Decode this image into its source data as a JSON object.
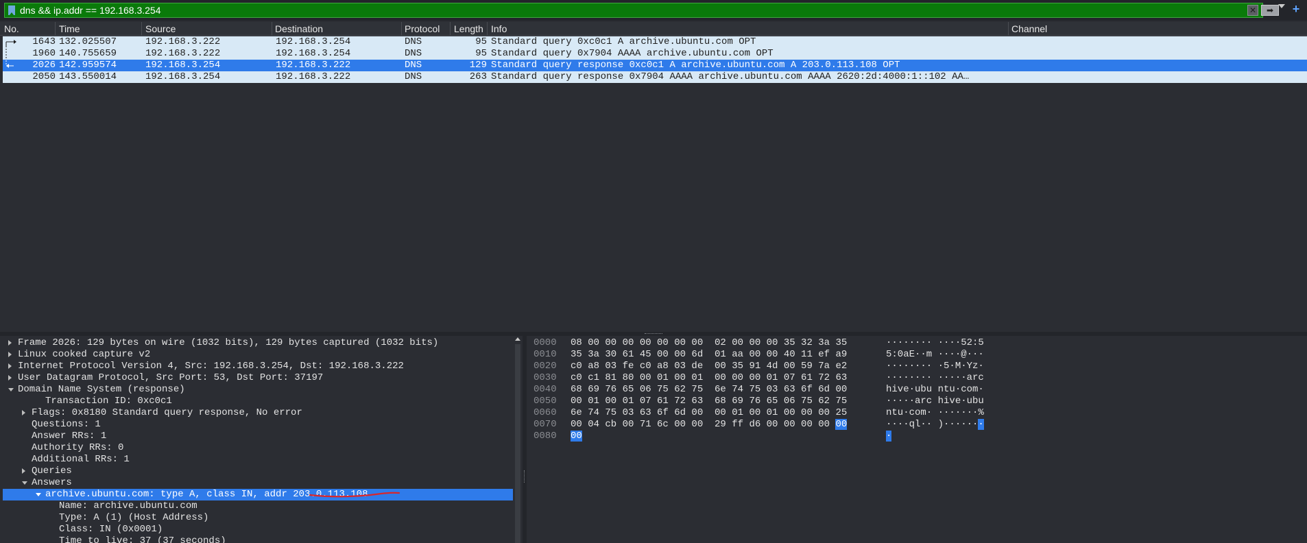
{
  "filter": {
    "text": "dns && ip.addr == 192.168.3.254",
    "clear_label": "✕",
    "apply_label": "➡",
    "add_label": "+"
  },
  "packet_list": {
    "columns": [
      "No.",
      "Time",
      "Source",
      "Destination",
      "Protocol",
      "Length",
      "Info",
      "Channel"
    ],
    "rows": [
      {
        "no": "1643",
        "time": "132.025507",
        "src": "192.168.3.222",
        "dst": "192.168.3.254",
        "proto": "DNS",
        "len": "95",
        "info": "Standard query 0xc0c1 A archive.ubuntu.com OPT",
        "selected": false
      },
      {
        "no": "1960",
        "time": "140.755659",
        "src": "192.168.3.222",
        "dst": "192.168.3.254",
        "proto": "DNS",
        "len": "95",
        "info": "Standard query 0x7904 AAAA archive.ubuntu.com OPT",
        "selected": false
      },
      {
        "no": "2026",
        "time": "142.959574",
        "src": "192.168.3.254",
        "dst": "192.168.3.222",
        "proto": "DNS",
        "len": "129",
        "info": "Standard query response 0xc0c1 A archive.ubuntu.com A 203.0.113.108 OPT",
        "selected": true
      },
      {
        "no": "2050",
        "time": "143.550014",
        "src": "192.168.3.254",
        "dst": "192.168.3.222",
        "proto": "DNS",
        "len": "263",
        "info": "Standard query response 0x7904 AAAA archive.ubuntu.com AAAA 2620:2d:4000:1::102 AA…",
        "selected": false
      }
    ]
  },
  "details": {
    "rows": [
      {
        "text": "Frame 2026: 129 bytes on wire (1032 bits), 129 bytes captured (1032 bits)",
        "indent": 0,
        "expander": "closed"
      },
      {
        "text": "Linux cooked capture v2",
        "indent": 0,
        "expander": "closed"
      },
      {
        "text": "Internet Protocol Version 4, Src: 192.168.3.254, Dst: 192.168.3.222",
        "indent": 0,
        "expander": "closed"
      },
      {
        "text": "User Datagram Protocol, Src Port: 53, Dst Port: 37197",
        "indent": 0,
        "expander": "closed"
      },
      {
        "text": "Domain Name System (response)",
        "indent": 0,
        "expander": "open"
      },
      {
        "text": "Transaction ID: 0xc0c1",
        "indent": 2,
        "expander": "none"
      },
      {
        "text": "Flags: 0x8180 Standard query response, No error",
        "indent": 1,
        "expander": "closed"
      },
      {
        "text": "Questions: 1",
        "indent": 1,
        "expander": "none"
      },
      {
        "text": "Answer RRs: 1",
        "indent": 1,
        "expander": "none"
      },
      {
        "text": "Authority RRs: 0",
        "indent": 1,
        "expander": "none"
      },
      {
        "text": "Additional RRs: 1",
        "indent": 1,
        "expander": "none"
      },
      {
        "text": "Queries",
        "indent": 1,
        "expander": "closed"
      },
      {
        "text": "Answers",
        "indent": 1,
        "expander": "open"
      },
      {
        "text": "archive.ubuntu.com: type A, class IN, addr 203.0.113.108",
        "indent": 2,
        "expander": "open",
        "selected": true
      },
      {
        "text": "Name: archive.ubuntu.com",
        "indent": 3,
        "expander": "none"
      },
      {
        "text": "Type: A (1) (Host Address)",
        "indent": 3,
        "expander": "none"
      },
      {
        "text": "Class: IN (0x0001)",
        "indent": 3,
        "expander": "none"
      },
      {
        "text": "Time to live: 37 (37 seconds)",
        "indent": 3,
        "expander": "none"
      }
    ]
  },
  "bytes": {
    "rows": [
      {
        "offset": "0000",
        "hex": "08 00 00 00 00 00 00 00  02 00 00 00 35 32 3a 35",
        "ascii": "········ ····52:5",
        "hl_hex_from": -1,
        "hl_ascii_from": -1
      },
      {
        "offset": "0010",
        "hex": "35 3a 30 61 45 00 00 6d  01 aa 00 00 40 11 ef a9",
        "ascii": "5:0aE··m ····@···",
        "hl_hex_from": -1,
        "hl_ascii_from": -1
      },
      {
        "offset": "0020",
        "hex": "c0 a8 03 fe c0 a8 03 de  00 35 91 4d 00 59 7a e2",
        "ascii": "········ ·5·M·Yz·",
        "hl_hex_from": -1,
        "hl_ascii_from": -1
      },
      {
        "offset": "0030",
        "hex": "c0 c1 81 80 00 01 00 01  00 00 00 01 07 61 72 63",
        "ascii": "········ ·····arc",
        "hl_hex_from": -1,
        "hl_ascii_from": -1
      },
      {
        "offset": "0040",
        "hex": "68 69 76 65 06 75 62 75  6e 74 75 03 63 6f 6d 00",
        "ascii": "hive·ubu ntu·com·",
        "hl_hex_from": -1,
        "hl_ascii_from": -1
      },
      {
        "offset": "0050",
        "hex": "00 01 00 01 07 61 72 63  68 69 76 65 06 75 62 75",
        "ascii": "·····arc hive·ubu",
        "hl_hex_from": -1,
        "hl_ascii_from": -1
      },
      {
        "offset": "0060",
        "hex": "6e 74 75 03 63 6f 6d 00  00 01 00 01 00 00 00 25",
        "ascii": "ntu·com· ·······%",
        "hl_hex_from": -1,
        "hl_ascii_from": -1
      },
      {
        "offset": "0070",
        "hex": "00 04 cb 00 71 6c 00 00  29 ff d6 00 00 00 00 00",
        "ascii": "····ql·· )·······",
        "hl_hex_from": 46,
        "hl_ascii_from": 16
      },
      {
        "offset": "0080",
        "hex": "00",
        "ascii": "·",
        "hl_hex_from": 0,
        "hl_ascii_from": 0
      }
    ]
  },
  "colors": {
    "filter_valid": "#0a7a0a",
    "row_bg": "#d8e9f6",
    "selection": "#2f7bea",
    "annotation": "#d9262a"
  }
}
